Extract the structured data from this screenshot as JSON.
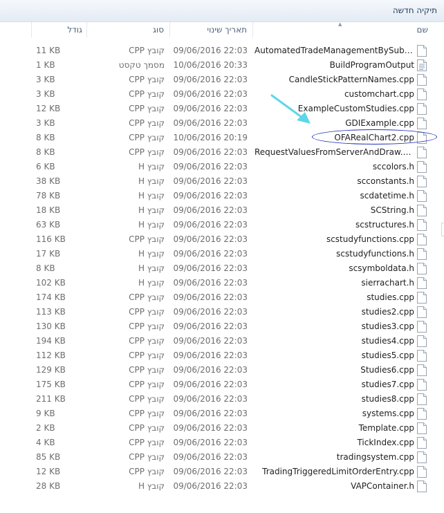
{
  "toolbar": {
    "new_folder_label": "תיקיה חדשה"
  },
  "columns": {
    "name": "שם",
    "date": "תאריך שינוי",
    "type": "סוג",
    "size": "גודל"
  },
  "files": [
    {
      "name": "AutomatedTradeManagementBySubgr...",
      "date": "09/06/2016 22:03",
      "type": "קובץ CPP",
      "size": "11 KB",
      "icon": "file-icon"
    },
    {
      "name": "BuildProgramOutput",
      "date": "10/06/2016 20:33",
      "type": "מסמך טקסט",
      "size": "1 KB",
      "icon": "text-document-icon"
    },
    {
      "name": "CandleStickPatternNames.cpp",
      "date": "09/06/2016 22:03",
      "type": "קובץ CPP",
      "size": "3 KB",
      "icon": "file-icon"
    },
    {
      "name": "customchart.cpp",
      "date": "09/06/2016 22:03",
      "type": "קובץ CPP",
      "size": "3 KB",
      "icon": "file-icon"
    },
    {
      "name": "ExampleCustomStudies.cpp",
      "date": "09/06/2016 22:03",
      "type": "קובץ CPP",
      "size": "12 KB",
      "icon": "file-icon"
    },
    {
      "name": "GDIExample.cpp",
      "date": "09/06/2016 22:03",
      "type": "קובץ CPP",
      "size": "3 KB",
      "icon": "file-icon"
    },
    {
      "name": "OFARealChart2.cpp",
      "date": "10/06/2016 20:19",
      "type": "קובץ CPP",
      "size": "8 KB",
      "icon": "file-icon"
    },
    {
      "name": "RequestValuesFromServerAndDraw.cpp",
      "date": "09/06/2016 22:03",
      "type": "קובץ CPP",
      "size": "8 KB",
      "icon": "file-icon"
    },
    {
      "name": "sccolors.h",
      "date": "09/06/2016 22:03",
      "type": "קובץ H",
      "size": "6 KB",
      "icon": "file-icon"
    },
    {
      "name": "scconstants.h",
      "date": "09/06/2016 22:03",
      "type": "קובץ H",
      "size": "38 KB",
      "icon": "file-icon"
    },
    {
      "name": "scdatetime.h",
      "date": "09/06/2016 22:03",
      "type": "קובץ H",
      "size": "78 KB",
      "icon": "file-icon"
    },
    {
      "name": "SCString.h",
      "date": "09/06/2016 22:03",
      "type": "קובץ H",
      "size": "18 KB",
      "icon": "file-icon"
    },
    {
      "name": "scstructures.h",
      "date": "09/06/2016 22:03",
      "type": "קובץ H",
      "size": "63 KB",
      "icon": "file-icon"
    },
    {
      "name": "scstudyfunctions.cpp",
      "date": "09/06/2016 22:03",
      "type": "קובץ CPP",
      "size": "116 KB",
      "icon": "file-icon"
    },
    {
      "name": "scstudyfunctions.h",
      "date": "09/06/2016 22:03",
      "type": "קובץ H",
      "size": "17 KB",
      "icon": "file-icon"
    },
    {
      "name": "scsymboldata.h",
      "date": "09/06/2016 22:03",
      "type": "קובץ H",
      "size": "8 KB",
      "icon": "file-icon"
    },
    {
      "name": "sierrachart.h",
      "date": "09/06/2016 22:03",
      "type": "קובץ H",
      "size": "102 KB",
      "icon": "file-icon"
    },
    {
      "name": "studies.cpp",
      "date": "09/06/2016 22:03",
      "type": "קובץ CPP",
      "size": "174 KB",
      "icon": "file-icon"
    },
    {
      "name": "studies2.cpp",
      "date": "09/06/2016 22:03",
      "type": "קובץ CPP",
      "size": "113 KB",
      "icon": "file-icon"
    },
    {
      "name": "studies3.cpp",
      "date": "09/06/2016 22:03",
      "type": "קובץ CPP",
      "size": "130 KB",
      "icon": "file-icon"
    },
    {
      "name": "studies4.cpp",
      "date": "09/06/2016 22:03",
      "type": "קובץ CPP",
      "size": "194 KB",
      "icon": "file-icon"
    },
    {
      "name": "studies5.cpp",
      "date": "09/06/2016 22:03",
      "type": "קובץ CPP",
      "size": "112 KB",
      "icon": "file-icon"
    },
    {
      "name": "Studies6.cpp",
      "date": "09/06/2016 22:03",
      "type": "קובץ CPP",
      "size": "129 KB",
      "icon": "file-icon"
    },
    {
      "name": "studies7.cpp",
      "date": "09/06/2016 22:03",
      "type": "קובץ CPP",
      "size": "175 KB",
      "icon": "file-icon"
    },
    {
      "name": "studies8.cpp",
      "date": "09/06/2016 22:03",
      "type": "קובץ CPP",
      "size": "211 KB",
      "icon": "file-icon"
    },
    {
      "name": "systems.cpp",
      "date": "09/06/2016 22:03",
      "type": "קובץ CPP",
      "size": "9 KB",
      "icon": "file-icon"
    },
    {
      "name": "Template.cpp",
      "date": "09/06/2016 22:03",
      "type": "קובץ CPP",
      "size": "2 KB",
      "icon": "file-icon"
    },
    {
      "name": "TickIndex.cpp",
      "date": "09/06/2016 22:03",
      "type": "קובץ CPP",
      "size": "4 KB",
      "icon": "file-icon"
    },
    {
      "name": "tradingsystem.cpp",
      "date": "09/06/2016 22:03",
      "type": "קובץ CPP",
      "size": "85 KB",
      "icon": "file-icon"
    },
    {
      "name": "TradingTriggeredLimitOrderEntry.cpp",
      "date": "09/06/2016 22:03",
      "type": "קובץ CPP",
      "size": "12 KB",
      "icon": "file-icon"
    },
    {
      "name": "VAPContainer.h",
      "date": "09/06/2016 22:03",
      "type": "קובץ H",
      "size": "28 KB",
      "icon": "file-icon"
    }
  ],
  "colors": {
    "annotation_arrow": "#5fd6e8",
    "annotation_circle": "#1f2fb4",
    "header_text": "#4c607a",
    "detail_text": "#6d6d6d"
  }
}
